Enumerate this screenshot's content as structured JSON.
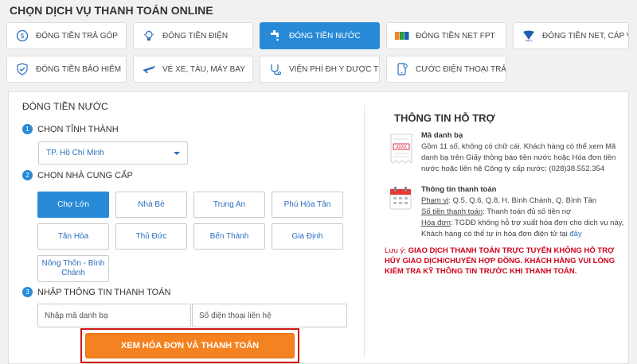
{
  "page_title": "CHỌN DỊCH VỤ THANH TOÁN ONLINE",
  "services": [
    {
      "label": "ĐÓNG TIỀN TRẢ GÓP",
      "icon": "coin-icon",
      "active": false
    },
    {
      "label": "ĐÓNG TIỀN ĐIỆN",
      "icon": "lightbulb-icon",
      "active": false
    },
    {
      "label": "ĐÓNG TIỀN NƯỚC",
      "icon": "faucet-icon",
      "active": true
    },
    {
      "label": "ĐÓNG TIỀN NET FPT",
      "icon": "fpt-logo-icon",
      "active": false
    },
    {
      "label": "ĐÓNG TIỀN NET, CÁP VNPT",
      "icon": "vnpt-logo-icon",
      "active": false
    },
    {
      "label": "ĐÓNG TIỀN BẢO HIỂM",
      "icon": "shield-check-icon",
      "active": false
    },
    {
      "label": "VÉ XE, TÀU, MÁY BAY",
      "icon": "airplane-icon",
      "active": false
    },
    {
      "label": "VIỆN PHÍ ĐH Y DƯỢC TPHCM",
      "icon": "stethoscope-icon",
      "active": false
    },
    {
      "label": "CƯỚC ĐIỆN THOẠI TRẢ SAU",
      "icon": "phone-icon",
      "active": false
    }
  ],
  "form": {
    "heading": "ĐÓNG TIỀN NƯỚC",
    "step1": {
      "num": "1",
      "label": "CHỌN TỈNH THÀNH"
    },
    "province_value": "TP. Hồ Chí Minh",
    "step2": {
      "num": "2",
      "label": "CHỌN NHÀ CUNG CẤP"
    },
    "providers": [
      {
        "label": "Chợ Lớn",
        "active": true
      },
      {
        "label": "Nhà Bè",
        "active": false
      },
      {
        "label": "Trung An",
        "active": false
      },
      {
        "label": "Phú Hòa Tân",
        "active": false
      },
      {
        "label": "Tân Hòa",
        "active": false
      },
      {
        "label": "Thủ Đức",
        "active": false
      },
      {
        "label": "Bến Thành",
        "active": false
      },
      {
        "label": "Gia Định",
        "active": false
      },
      {
        "label": "Nông Thôn - Bình Chánh",
        "active": false
      }
    ],
    "step3": {
      "num": "3",
      "label": "NHẬP THÔNG TIN THANH TOÁN"
    },
    "account_placeholder": "Nhập mã danh bạ",
    "phone_placeholder": "Số điện thoại liên hệ",
    "submit_label": "XEM HÓA ĐƠN VÀ THANH TOÁN"
  },
  "support": {
    "title": "THÔNG TIN HỖ TRỢ",
    "code_title": "Mã danh bạ",
    "code_text": "Gồm 11 số, không có chữ cái. Khách hàng có thể xem Mã danh bạ trên Giấy thông báo tiền nước hoặc Hóa đơn tiền nước hoặc liên hệ Công ty cấp nước: (028)38.552.354",
    "code_icon_text": "XXXX",
    "pay_title": "Thông tin thanh toán",
    "scope_label": "Phạm vi",
    "scope_text": ": Q.5, Q.6, Q.8, H. Bình Chánh, Q. Bình Tân",
    "amount_label": "Số tiền thanh toán",
    "amount_text": ": Thanh toán đủ số tiền nợ",
    "invoice_label": "Hóa đơn",
    "invoice_text": ": TGDĐ không hỗ trợ xuất hóa đơn cho dịch vụ này, Khách hàng có thể tự in hóa đơn điện tử tại ",
    "invoice_link": "đây",
    "warning_label": "Lưu ý:",
    "warning_text": " GIAO DỊCH THANH TOÁN TRỰC TUYẾN KHÔNG HỖ TRỢ HỦY GIAO DỊCH/CHUYỂN HỢP ĐỒNG. KHÁCH HÀNG VUI LÒNG KIỂM TRA KỸ THÔNG TIN TRƯỚC KHI THANH TOÁN."
  },
  "colors": {
    "accent": "#288ad6",
    "button": "#f58220",
    "warning": "#d0021b",
    "highlight_border": "#d01515"
  }
}
